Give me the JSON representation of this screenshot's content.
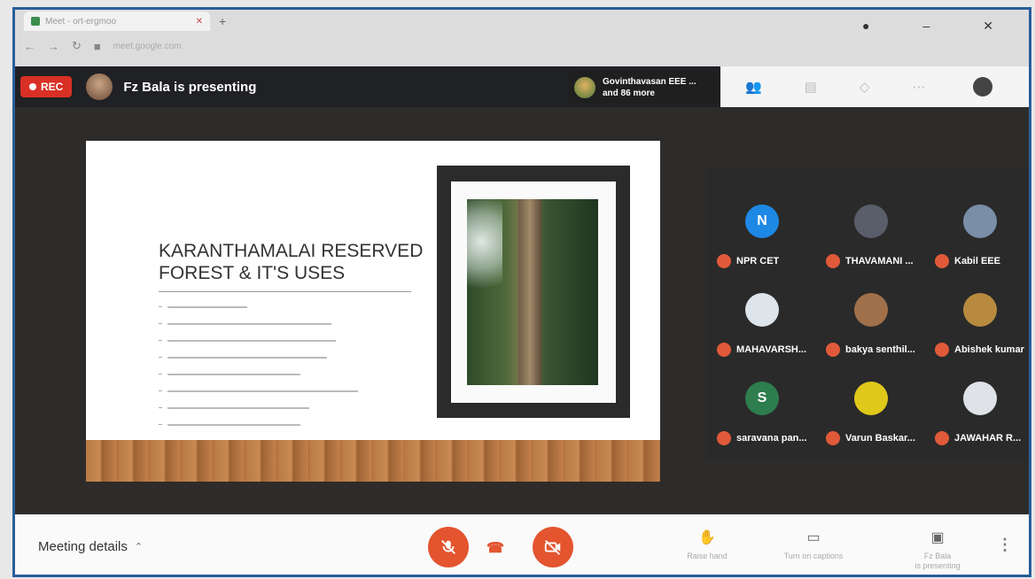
{
  "browser": {
    "tab_title": "Meet - ort-ergmoo",
    "address": "meet.google.com"
  },
  "meetbar": {
    "rec_label": "REC",
    "presenting_text": "Fz Bala is presenting",
    "participants_line1": "Govinthavasan EEE ...",
    "participants_line2": "and 86 more"
  },
  "slide": {
    "title": "KARANTHAMALAI RESERVED FOREST & IT'S USES",
    "bullet_count_widths": [
      90,
      185,
      190,
      180,
      150,
      215,
      160,
      150
    ]
  },
  "participants": [
    {
      "name": "NPR CET",
      "initial": "N",
      "color": "#1e88e5"
    },
    {
      "name": "THAVAMANI ...",
      "initial": "",
      "color": "#5a5e6a"
    },
    {
      "name": "Kabil EEE",
      "initial": "",
      "color": "#7a8ea8"
    },
    {
      "name": "MAHAVARSH...",
      "initial": "",
      "color": "#dde4ea"
    },
    {
      "name": "bakya senthil...",
      "initial": "",
      "color": "#a0704a"
    },
    {
      "name": "Abishek kumar",
      "initial": "",
      "color": "#b88a40"
    },
    {
      "name": "saravana pan...",
      "initial": "S",
      "color": "#2e7d4f"
    },
    {
      "name": "Varun Baskar...",
      "initial": "",
      "color": "#e0c81a"
    },
    {
      "name": "JAWAHAR R...",
      "initial": "",
      "color": "#dfe3e8"
    }
  ],
  "bottom": {
    "meeting_details": "Meeting details",
    "raise_hand": "Raise hand",
    "captions": "Turn on captions",
    "presenting_line1": "Fz Bala",
    "presenting_line2": "is presenting"
  },
  "colors": {
    "accent_red": "#e3542f",
    "rec_red": "#d93025",
    "frame_blue": "#2a5d9a"
  }
}
